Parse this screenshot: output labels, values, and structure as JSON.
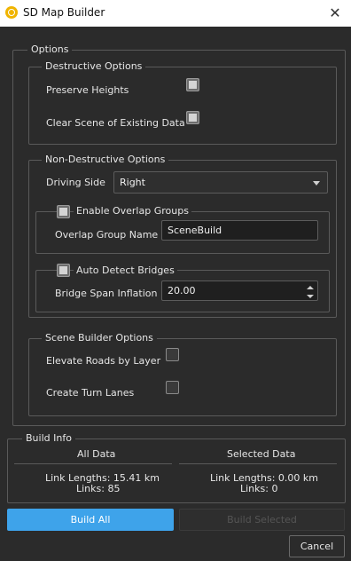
{
  "window": {
    "title": "SD Map Builder",
    "icon": "app-logo-icon",
    "close_glyph": "✕"
  },
  "options": {
    "legend": "Options",
    "destructive": {
      "legend": "Destructive Options",
      "preserve_heights": "Preserve Heights",
      "clear_scene": "Clear Scene of Existing Data"
    },
    "non_destructive": {
      "legend": "Non-Destructive Options",
      "driving_side_label": "Driving Side",
      "driving_side_value": "Right",
      "overlap": {
        "checkbox_label": "Enable Overlap Groups",
        "name_label": "Overlap Group Name",
        "name_value": "SceneBuild"
      },
      "bridges": {
        "checkbox_label": "Auto Detect Bridges",
        "span_label": "Bridge Span Inflation",
        "span_value": "20.00"
      }
    },
    "scene_builder": {
      "legend": "Scene Builder Options",
      "elevate_roads": "Elevate Roads by Layer",
      "turn_lanes": "Create Turn Lanes"
    }
  },
  "build_info": {
    "legend": "Build Info",
    "all_header": "All Data",
    "selected_header": "Selected Data",
    "all_link_lengths": "Link Lengths: 15.41 km",
    "all_links": "Links: 85",
    "sel_link_lengths": "Link Lengths: 0.00 km",
    "sel_links": "Links: 0"
  },
  "actions": {
    "build_all": "Build All",
    "build_selected": "Build Selected",
    "cancel": "Cancel"
  },
  "colors": {
    "accent": "#3ea3ea",
    "background": "#2b2b2b"
  }
}
